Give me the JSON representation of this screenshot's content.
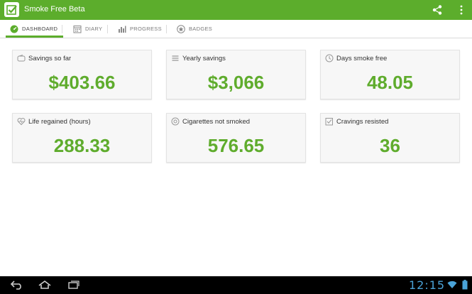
{
  "app": {
    "title": "Smoke Free Beta",
    "accent_color": "#5cad2c",
    "icons": {
      "app": "checkmark-app-icon",
      "share": "share-icon",
      "overflow": "overflow-menu-icon"
    }
  },
  "tabs": [
    {
      "label": "DASHBOARD",
      "icon": "speedometer-icon",
      "active": true
    },
    {
      "label": "DIARY",
      "icon": "calendar-icon",
      "active": false
    },
    {
      "label": "PROGRESS",
      "icon": "bar-chart-icon",
      "active": false
    },
    {
      "label": "BADGES",
      "icon": "star-badge-icon",
      "active": false
    }
  ],
  "cards": [
    {
      "label": "Savings so far",
      "value": "$403.66",
      "icon": "wallet-icon"
    },
    {
      "label": "Yearly savings",
      "value": "$3,066",
      "icon": "coins-icon"
    },
    {
      "label": "Days smoke free",
      "value": "48.05",
      "icon": "clock-icon"
    },
    {
      "label": "Life regained (hours)",
      "value": "288.33",
      "icon": "heart-icon"
    },
    {
      "label": "Cigarettes not smoked",
      "value": "576.65",
      "icon": "no-smoking-icon"
    },
    {
      "label": "Cravings resisted",
      "value": "36",
      "icon": "checkbox-icon"
    }
  ],
  "system_bar": {
    "time": "12:15",
    "clock_color": "#4aa3d8"
  }
}
